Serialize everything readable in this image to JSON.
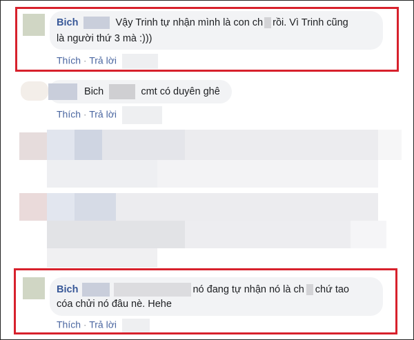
{
  "comments": [
    {
      "author": "Bich",
      "line1": "Vậy Trinh tự nhận mình là con ch",
      "line1_tail": "rồi. Vì Trinh cũng",
      "line2": "là người thứ 3 mà :)))",
      "actions": {
        "like": "Thích",
        "dot": "·",
        "reply": "Trả lời"
      }
    },
    {
      "author": "Bich",
      "text": "cmt có duyên ghê",
      "actions": {
        "like": "Thích",
        "dot": "·",
        "reply": "Trả lời"
      }
    },
    {
      "author": "Bich",
      "line1": "nó đang tự nhận nó là ch",
      "line1_tail": "chứ tao",
      "line2": "cóa chửi nó đâu nè. Hehe",
      "actions": {
        "like": "Thích",
        "dot": "·",
        "reply": "Trả lời"
      }
    }
  ],
  "colors": {
    "highlight_border": "#d7212c",
    "author_link": "#385898",
    "action_link": "#4b67a1",
    "bubble_bg": "#f2f3f5"
  }
}
